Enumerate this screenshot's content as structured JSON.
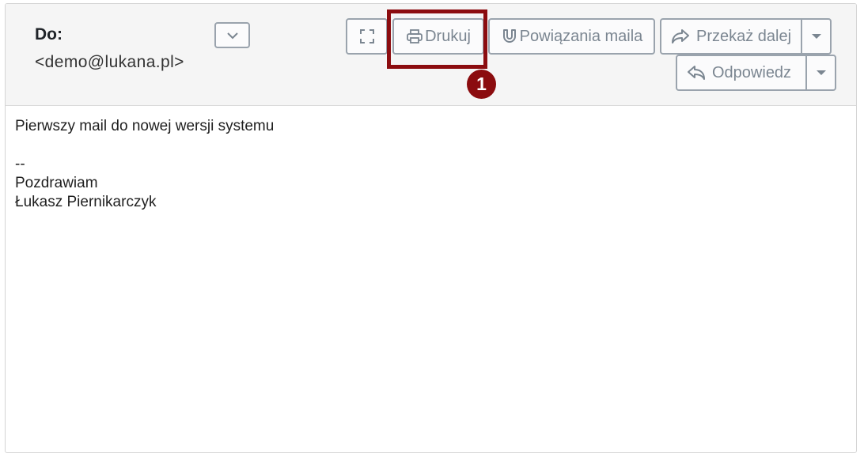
{
  "header": {
    "to_label": "Do:",
    "to_email": "<demo@lukana.pl>"
  },
  "toolbar": {
    "print_label": "Drukuj",
    "relations_label": "Powiązania maila",
    "forward_label": "Przekaż dalej",
    "reply_label": "Odpowiedz"
  },
  "annotation": {
    "marker_number": "1",
    "highlight_color": "#8b0c0f"
  },
  "message": {
    "lines": [
      "Pierwszy mail do nowej wersji systemu",
      "",
      "--",
      "Pozdrawiam",
      "Łukasz Piernikarczyk"
    ]
  },
  "icons": {
    "expand": "chevron-down-icon",
    "fullscreen": "fullscreen-icon",
    "print": "printer-icon",
    "relations": "magnet-icon",
    "forward": "share-arrow-icon",
    "reply": "reply-arrow-icon"
  }
}
